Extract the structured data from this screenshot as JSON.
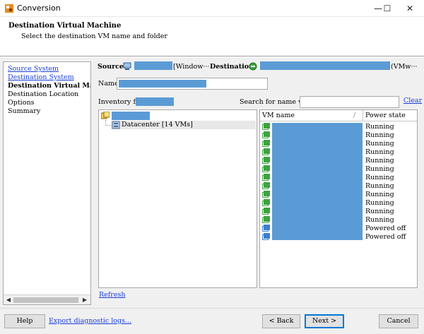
{
  "window": {
    "title": "Conversion",
    "controls": {
      "minimize": "—",
      "maximize": "☐",
      "close": "✕"
    }
  },
  "header": {
    "title": "Destination Virtual Machine",
    "subtitle": "Select the destination VM name and folder"
  },
  "nav": {
    "items": [
      {
        "label": "Source System",
        "state": "link"
      },
      {
        "label": "Destination System",
        "state": "link"
      },
      {
        "label": "Destination Virtual Machine",
        "state": "current"
      },
      {
        "label": "Destination Location",
        "state": "plain"
      },
      {
        "label": "Options",
        "state": "plain"
      },
      {
        "label": "Summary",
        "state": "plain"
      }
    ],
    "scroll_left": "◀",
    "scroll_right": "▶"
  },
  "source": {
    "label": "Source:",
    "value": "[Window···"
  },
  "destination": {
    "label": "Destination:",
    "value": "(VMw···"
  },
  "name_field": {
    "label": "Name:",
    "value": ""
  },
  "inventory": {
    "label": "Inventory for:"
  },
  "search": {
    "label": "Search for name with:",
    "value": "",
    "clear": "Clear"
  },
  "tree": {
    "datacenter": "Datacenter [14 VMs]"
  },
  "vm_table": {
    "col_name": "VM name",
    "col_state": "Power state",
    "sort_glyph": "/",
    "rows": [
      {
        "state": "Running",
        "kind": "on"
      },
      {
        "state": "Running",
        "kind": "on"
      },
      {
        "state": "Running",
        "kind": "on"
      },
      {
        "state": "Running",
        "kind": "on"
      },
      {
        "state": "Running",
        "kind": "on"
      },
      {
        "state": "Running",
        "kind": "on"
      },
      {
        "state": "Running",
        "kind": "on"
      },
      {
        "state": "Running",
        "kind": "on"
      },
      {
        "state": "Running",
        "kind": "on"
      },
      {
        "state": "Running",
        "kind": "on"
      },
      {
        "state": "Running",
        "kind": "on"
      },
      {
        "state": "Running",
        "kind": "on"
      },
      {
        "state": "Powered off",
        "kind": "off"
      },
      {
        "state": "Powered off",
        "kind": "off"
      }
    ]
  },
  "refresh": "Refresh",
  "footer": {
    "help": "Help",
    "export_logs": "Export diagnostic logs...",
    "back": "< Back",
    "next": "Next >",
    "cancel": "Cancel"
  },
  "colors": {
    "redaction": "#5b9bd5",
    "link": "#1a3ed8",
    "vm_on": "#3da33d",
    "vm_off": "#3c7fd0"
  }
}
